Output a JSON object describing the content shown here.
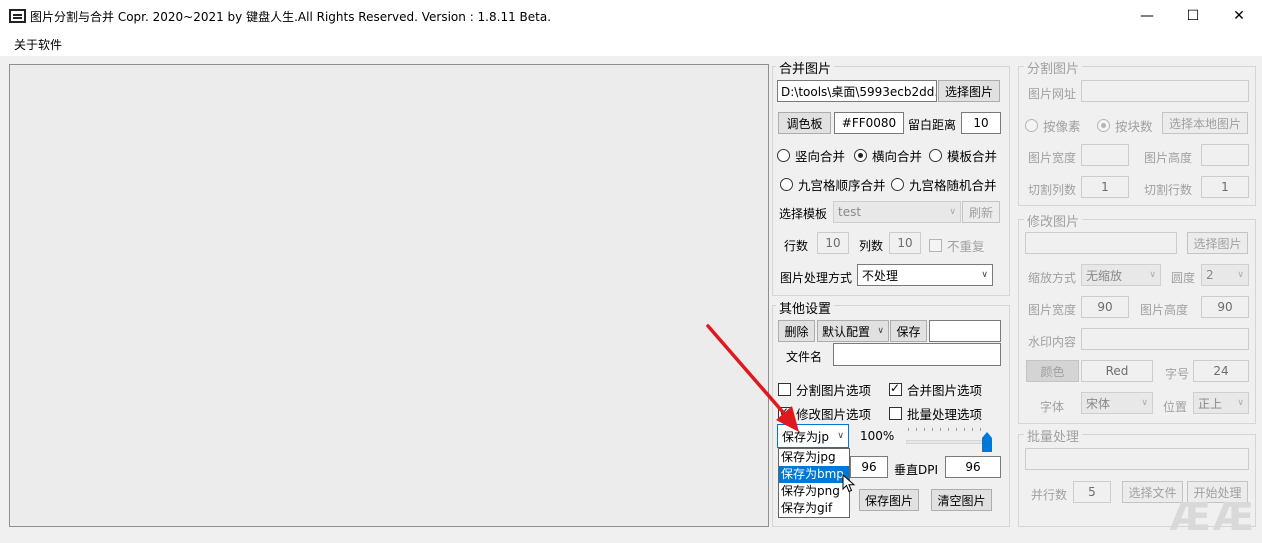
{
  "window": {
    "title": "图片分割与合并    Copr. 2020~2021 by 键盘人生.All Rights Reserved.  Version : 1.8.11 Beta.",
    "minimize": "—",
    "maximize": "☐",
    "close": "✕"
  },
  "menu": {
    "about": "关于软件"
  },
  "merge": {
    "group_label": "合并图片",
    "path_value": "D:\\tools\\桌面\\5993ecb2dd.",
    "select_button": "选择图片",
    "palette_button": "调色板",
    "color_value": "#FF0080",
    "margin_label": "留白距离",
    "margin_value": "10",
    "modes": [
      "竖向合并",
      "横向合并",
      "模板合并"
    ],
    "grid_modes": [
      "九宫格顺序合并",
      "九宫格随机合并"
    ],
    "template_label": "选择模板",
    "template_value": "test",
    "refresh_button": "刷新",
    "rows_label": "行数",
    "rows_value": "10",
    "cols_label": "列数",
    "cols_value": "10",
    "no_repeat": "不重复",
    "process_label": "图片处理方式",
    "process_value": "不处理"
  },
  "other": {
    "group_label": "其他设置",
    "delete_button": "删除",
    "config_value": "默认配置",
    "save_button": "保存",
    "config_name": "",
    "filename_label": "文件名",
    "filename_value": "",
    "opt_split": "分割图片选项",
    "opt_merge": "合并图片选项",
    "opt_modify": "修改图片选项",
    "opt_batch": "批量处理选项",
    "format_value": "保存为jp",
    "format_options": [
      "保存为jpg",
      "保存为bmp",
      "保存为png",
      "保存为gif"
    ],
    "quality": "100%",
    "hdpi_value": "96",
    "vdpi_label": "垂直DPI",
    "vdpi_value": "96",
    "save_image_button": "保存图片",
    "clear_image_button": "清空图片"
  },
  "split": {
    "group_label": "分割图片",
    "url_label": "图片网址",
    "by_pixel": "按像素",
    "by_count": "按块数",
    "select_local": "选择本地图片",
    "width_label": "图片宽度",
    "height_label": "图片高度",
    "cols_label": "切割列数",
    "cols_value": "1",
    "rows_label": "切割行数",
    "rows_value": "1"
  },
  "modify": {
    "group_label": "修改图片",
    "select_button": "选择图片",
    "scale_label": "缩放方式",
    "scale_value": "无缩放",
    "round_label": "圆度",
    "round_value": "2",
    "width_label": "图片宽度",
    "width_value": "90",
    "height_label": "图片高度",
    "height_value": "90",
    "watermark_label": "水印内容",
    "color_button": "颜色",
    "color_value": "Red",
    "size_label": "字号",
    "size_value": "24",
    "font_label": "字体",
    "font_value": "宋体",
    "position_label": "位置",
    "position_value": "正上"
  },
  "batch": {
    "group_label": "批量处理",
    "threads_label": "并行数",
    "threads_value": "5",
    "select_folder": "选择文件",
    "start_button": "开始处理"
  },
  "icons": {
    "app": "app-icon",
    "dropdown": "chevron-down-icon",
    "pointer": "cursor-icon",
    "annotation": "red-arrow-icon"
  },
  "colors": {
    "accent": "#0078d7",
    "annotation": "#e0191e"
  },
  "watermark": {
    "text": "ÆÆ"
  }
}
